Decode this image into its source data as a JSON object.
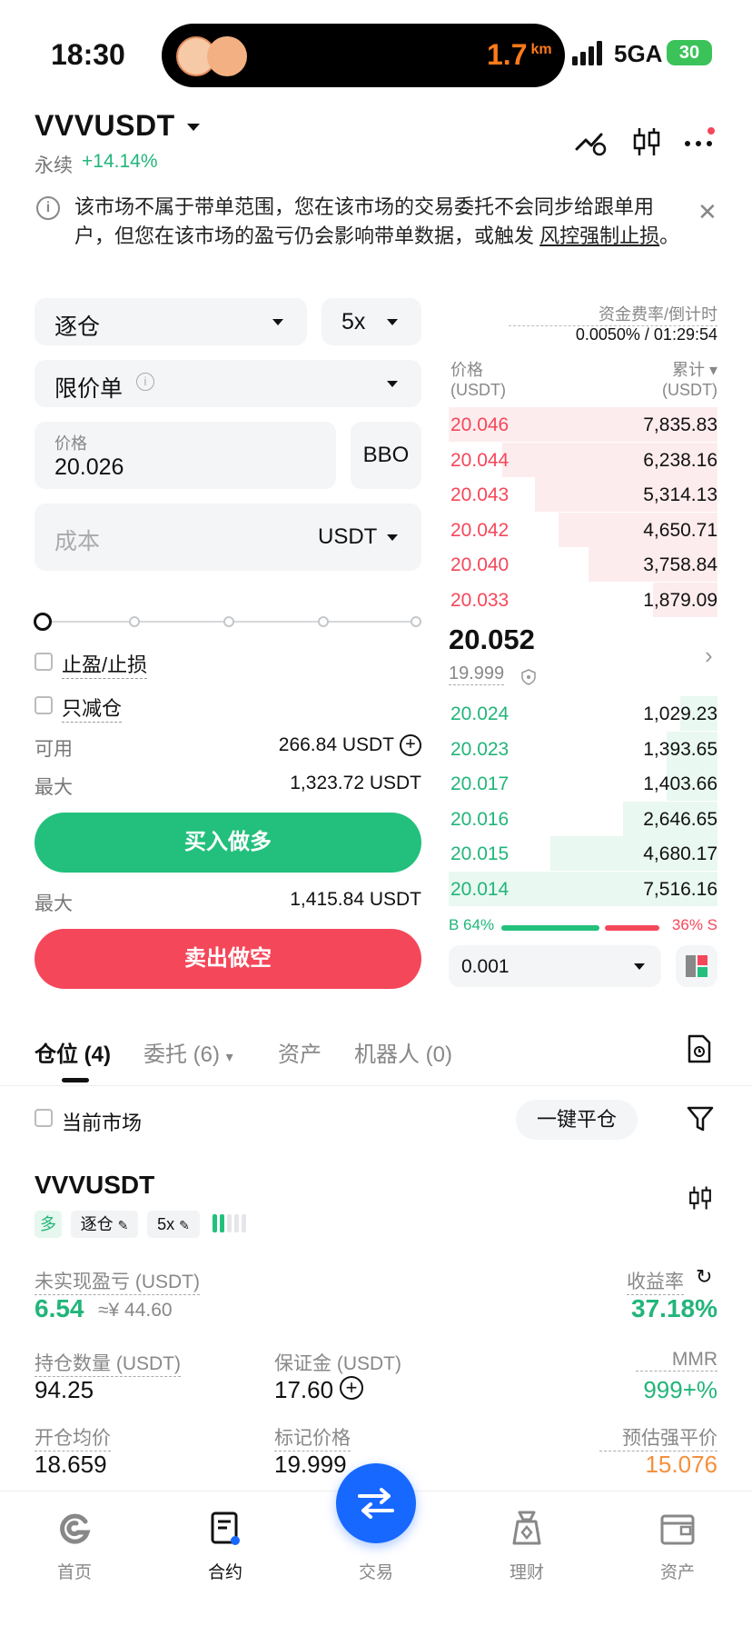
{
  "status": {
    "time": "18:30",
    "distance": "1.7",
    "distance_unit": "km",
    "network": "5GA",
    "battery": "30"
  },
  "header": {
    "pair": "VVVUSDT",
    "type": "永续",
    "change": "+14.14%"
  },
  "notice": {
    "text": "该市场不属于带单范围，您在该市场的交易委托不会同步给跟单用户，但您在该市场的盈亏仍会影响带单数据，或触发 ",
    "link": "风控强制止损",
    "tail": "。"
  },
  "form": {
    "margin_mode": "逐仓",
    "leverage": "5x",
    "order_type": "限价单",
    "price_label": "价格",
    "price_value": "20.026",
    "bbo": "BBO",
    "cost_placeholder": "成本",
    "cost_unit": "USDT",
    "tpsl_label": "止盈/止损",
    "reduce_only_label": "只减仓",
    "available_label": "可用",
    "available_value": "266.84 USDT",
    "max_label_buy": "最大",
    "max_value_buy": "1,323.72 USDT",
    "buy_label": "买入做多",
    "max_label_sell": "最大",
    "max_value_sell": "1,415.84 USDT",
    "sell_label": "卖出做空"
  },
  "orderbook": {
    "funding_label": "资金费率/倒计时",
    "funding_value": "0.0050% / 01:29:54",
    "price_header": "价格",
    "price_unit": "(USDT)",
    "total_header": "累计",
    "total_unit": "(USDT)",
    "asks": [
      {
        "price": "20.046",
        "total": "7,835.83",
        "depth": 1.0
      },
      {
        "price": "20.044",
        "total": "6,238.16",
        "depth": 0.8
      },
      {
        "price": "20.043",
        "total": "5,314.13",
        "depth": 0.68
      },
      {
        "price": "20.042",
        "total": "4,650.71",
        "depth": 0.59
      },
      {
        "price": "20.040",
        "total": "3,758.84",
        "depth": 0.48
      },
      {
        "price": "20.033",
        "total": "1,879.09",
        "depth": 0.24
      }
    ],
    "last_price": "20.052",
    "mark_price": "19.999",
    "bids": [
      {
        "price": "20.024",
        "total": "1,029.23",
        "depth": 0.14
      },
      {
        "price": "20.023",
        "total": "1,393.65",
        "depth": 0.19
      },
      {
        "price": "20.017",
        "total": "1,403.66",
        "depth": 0.19
      },
      {
        "price": "20.016",
        "total": "2,646.65",
        "depth": 0.35
      },
      {
        "price": "20.015",
        "total": "4,680.17",
        "depth": 0.62
      },
      {
        "price": "20.014",
        "total": "7,516.16",
        "depth": 1.0
      }
    ],
    "buy_ratio_label": "B 64%",
    "sell_ratio_label": "36% S",
    "buy_ratio": 0.64,
    "precision": "0.001"
  },
  "tabs": {
    "positions": "仓位 (4)",
    "orders": "委托 (6)",
    "assets": "资产",
    "bots": "机器人 (0)"
  },
  "positions_panel": {
    "current_market_label": "当前市场",
    "close_all": "一键平仓",
    "pair": "VVVUSDT",
    "side_tag": "多",
    "margin_tag": "逐仓",
    "leverage_tag": "5x",
    "pnl_label": "未实现盈亏 (USDT)",
    "pnl_value": "6.54",
    "pnl_cny": "≈¥ 44.60",
    "roe_label": "收益率",
    "roe_value": "37.18%",
    "size_label": "持仓数量 (USDT)",
    "size_value": "94.25",
    "margin_label": "保证金 (USDT)",
    "margin_value": "17.60",
    "mmr_label": "MMR",
    "mmr_value": "999+%",
    "entry_label": "开仓均价",
    "entry_value": "18.659",
    "mark_label": "标记价格",
    "mark_value": "19.999",
    "liq_label": "预估强平价",
    "liq_value": "15.076"
  },
  "nav": {
    "home": "首页",
    "contract": "合约",
    "trade": "交易",
    "finance": "理财",
    "assets": "资产"
  },
  "colors": {
    "green": "#22b57a",
    "red": "#f5475a",
    "blue": "#1768ff",
    "orange": "#f5903d"
  }
}
